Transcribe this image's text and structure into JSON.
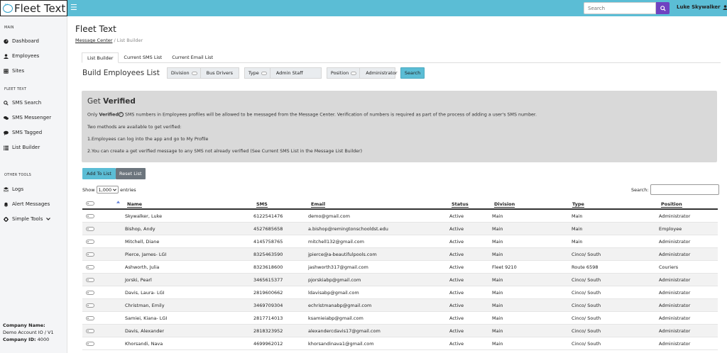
{
  "app": {
    "logo_text": "Fleet Text"
  },
  "topbar": {
    "search_placeholder": "Search",
    "user_name": "Luke Skywalker"
  },
  "sidebar": {
    "sections": [
      {
        "heading": "MAIN",
        "items": [
          {
            "label": "Dashboard",
            "icon": "dashboard-icon"
          },
          {
            "label": "Employees",
            "icon": "user-icon"
          },
          {
            "label": "Sites",
            "icon": "building-icon"
          }
        ]
      },
      {
        "heading": "FLEET TEXT",
        "items": [
          {
            "label": "SMS Search",
            "icon": "search-icon"
          },
          {
            "label": "SMS Messenger",
            "icon": "comments-icon"
          },
          {
            "label": "SMS Tagged",
            "icon": "comment-icon"
          },
          {
            "label": "List Builder",
            "icon": "list-icon"
          }
        ]
      },
      {
        "heading": "OTHER TOOLS",
        "items": [
          {
            "label": "Logs",
            "icon": "layers-icon"
          },
          {
            "label": "Alert Messages",
            "icon": "bell-icon"
          },
          {
            "label": "Simple Tools",
            "icon": "gear-icon"
          }
        ]
      }
    ],
    "company": {
      "name_label": "Company Name:",
      "name": "Demo Account IO / V1",
      "id_label": "Company ID:",
      "id": "4000"
    }
  },
  "page": {
    "title": "Fleet Text",
    "breadcrumb": {
      "link": "Message Center",
      "separator": "/",
      "current": "List Builder"
    },
    "tabs": [
      "List Builder",
      "Current SMS List",
      "Current Email List"
    ],
    "build_title": "Build Employees List",
    "filters": [
      {
        "label": "Division",
        "value": "Bus Drivers"
      },
      {
        "label": "Type",
        "value": "Admin Staff"
      },
      {
        "label": "Position",
        "value": "Administrator"
      }
    ],
    "search_button": "Search"
  },
  "verified": {
    "title_prefix": "Get",
    "title_bold": "Verified",
    "line1_pre": "Only",
    "line1_bold": "Verified",
    "line1_post": "SMS numbers in Employees profiles will be allowed to be messaged from the Message Center. Verification of numbers is required as part of the process of adding a user's SMS number.",
    "line2": "Two methods are available to get verified:",
    "line3": "1.Employees can log into the app and go to My Profile",
    "line4": "2.You can create a get verified message to any SMS not already verified (See Current SMS List in the Message List Builder)"
  },
  "actions": {
    "add": "Add To List",
    "reset": "Reset List"
  },
  "table_controls": {
    "show_label": "Show",
    "show_value": "1,000",
    "entries_label": "entries",
    "search_label": "Search:"
  },
  "table": {
    "columns": [
      "Name",
      "SMS",
      "Email",
      "Status",
      "Division",
      "Type",
      "Position"
    ],
    "rows": [
      [
        "Skywalker, Luke",
        "6122541476",
        "demo@gmail.com",
        "Active",
        "Main",
        "Main",
        "Administrator"
      ],
      [
        "Bishop, Andy",
        "4527685658",
        "a.bishop@remingtonschooldst.edu",
        "Active",
        "Main",
        "Main",
        "Employee"
      ],
      [
        "Mitchell, Diane",
        "4145758765",
        "mitchell132@gmail.com",
        "Active",
        "Main",
        "Main",
        "Administrator"
      ],
      [
        "Pierce, James- LGI",
        "8325463590",
        "jpierce@a-beautifulpools.com",
        "Active",
        "Main",
        "Cinco/ South",
        "Administrator"
      ],
      [
        "Ashworth, Julia",
        "8323618600",
        "jashworth317@gmail.com",
        "Active",
        "Fleet 9210",
        "Route 6598",
        "Couriers"
      ],
      [
        "Jorski, Pearl",
        "3465615377",
        "pjorskiabp@gmail.com",
        "Active",
        "Main",
        "Cinco/ South",
        "Administrator"
      ],
      [
        "Davis, Laura- LGI",
        "2819600662",
        "ldavisabp@gmail.com",
        "Active",
        "Main",
        "Cinco/ South",
        "Administrator"
      ],
      [
        "Christman, Emily",
        "3469709304",
        "echristmanabp@gmail.com",
        "Active",
        "Main",
        "Cinco/ South",
        "Administrator"
      ],
      [
        "Samiei, Kiana- LGI",
        "2817714013",
        "ksamieiabp@gmail.com",
        "Active",
        "Main",
        "Cinco/ South",
        "Administrator"
      ],
      [
        "Davis, Alexander",
        "2818323952",
        "alexandercdavis17@gmail.com",
        "Active",
        "Main",
        "Cinco/ South",
        "Administrator"
      ],
      [
        "Khorsandi, Nava",
        "4699962012",
        "khorsandinava1@gmail.com",
        "Active",
        "Main",
        "Cinco/ South",
        "Administrator"
      ]
    ]
  }
}
